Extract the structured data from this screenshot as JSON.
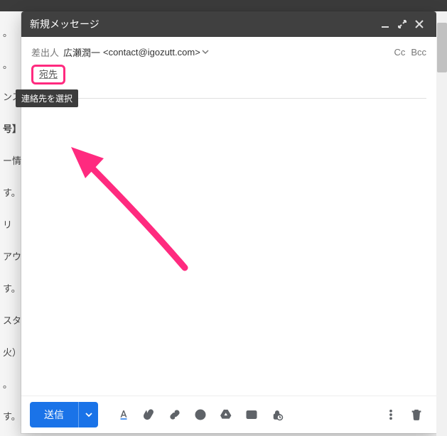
{
  "compose": {
    "title": "新規メッセージ",
    "from_label": "差出人",
    "from_name": "広瀬潤一",
    "from_email": "<contact@igozutt.com>",
    "from_dropdown_icon": "chevron-down",
    "cc_label": "Cc",
    "bcc_label": "Bcc",
    "to_label": "宛先",
    "to_tooltip": "連絡先を選択",
    "send_label": "送信"
  },
  "toolbar_icons": [
    "format-icon",
    "attach-icon",
    "link-icon",
    "emoji-icon",
    "drive-icon",
    "image-icon",
    "confidential-icon"
  ],
  "right_icons": [
    "more-icon",
    "trash-icon"
  ],
  "background_snippets": {
    "top": "…",
    "rows": [
      "。",
      "。",
      "ンス",
      "号】",
      "ー情",
      "す。",
      "リ",
      "アウ",
      "す。",
      "スタ",
      "火）",
      "。",
      "す。"
    ]
  },
  "annotation": {
    "arrow_color": "#ff2a7f"
  }
}
